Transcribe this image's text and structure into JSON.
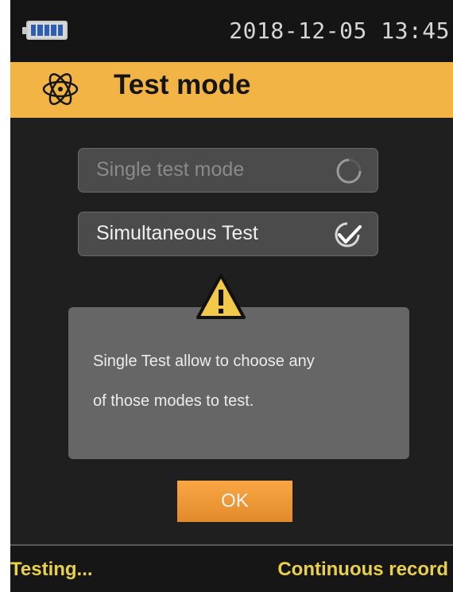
{
  "status_bar": {
    "datetime": "2018-12-05  13:45",
    "battery_icon": "battery-full-icon"
  },
  "header": {
    "title": "Test mode",
    "icon": "atom-icon",
    "accent_color": "#f2b545"
  },
  "options": [
    {
      "label": "Single test mode",
      "state": "loading",
      "disabled": true
    },
    {
      "label": "Simultaneous Test",
      "state": "selected",
      "disabled": false
    }
  ],
  "dialog": {
    "icon": "warning-icon",
    "line1": "Single Test allow to choose any",
    "line2": "of those modes to test.",
    "ok_label": "OK"
  },
  "footer": {
    "left": "Testing...",
    "right": "Continuous record",
    "text_color": "#e9d04c"
  }
}
